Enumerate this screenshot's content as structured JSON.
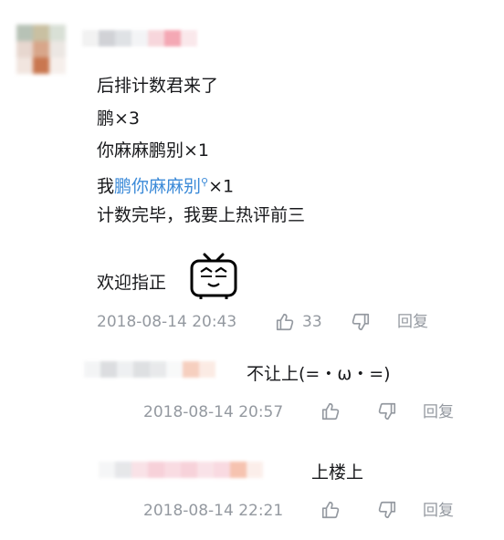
{
  "main_comment": {
    "lines": {
      "l1": "后排计数君来了",
      "l2": "鹏×3",
      "l3": "你麻麻鹏别×1",
      "l4_prefix": "我",
      "l4_link": "鹏你麻麻别",
      "l4_suffix": "×1",
      "l5": "计数完毕，我要上热评前三",
      "l6": "欢迎指正"
    },
    "time": "2018-08-14 20:43",
    "likes": "33",
    "reply_label": "回复"
  },
  "replies": [
    {
      "text": "不让上(=・ω・=)",
      "time": "2018-08-14 20:57",
      "reply_label": "回复"
    },
    {
      "text": "上楼上",
      "time": "2018-08-14 22:21",
      "reply_label": "回复"
    }
  ],
  "icons": {
    "emoji": "tv-emoji-icon",
    "like": "thumb-up-icon",
    "dislike": "thumb-down-icon",
    "search": "search-icon"
  }
}
